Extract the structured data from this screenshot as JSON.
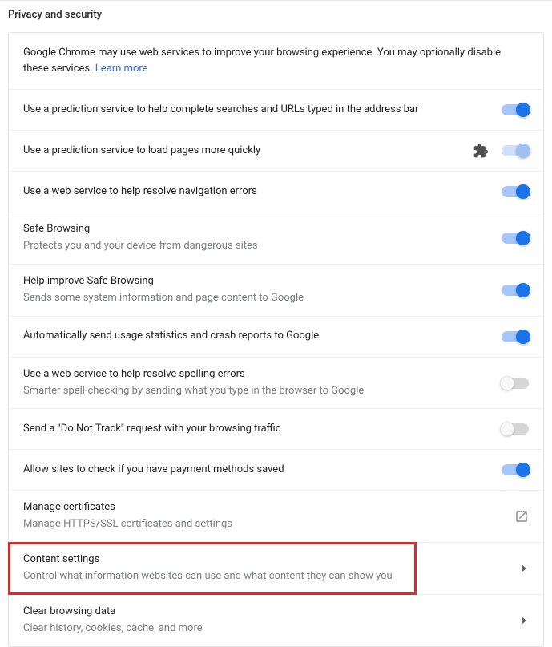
{
  "header": {
    "title": "Privacy and security"
  },
  "intro": {
    "text": "Google Chrome may use web services to improve your browsing experience. You may optionally disable these services. ",
    "link_label": "Learn more"
  },
  "rows": {
    "prediction_search": {
      "title": "Use a prediction service to help complete searches and URLs typed in the address bar"
    },
    "prediction_pages": {
      "title": "Use a prediction service to load pages more quickly"
    },
    "nav_errors": {
      "title": "Use a web service to help resolve navigation errors"
    },
    "safe_browsing": {
      "title": "Safe Browsing",
      "subtitle": "Protects you and your device from dangerous sites"
    },
    "improve_sb": {
      "title": "Help improve Safe Browsing",
      "subtitle": "Sends some system information and page content to Google"
    },
    "crash_reports": {
      "title": "Automatically send usage statistics and crash reports to Google"
    },
    "spelling": {
      "title": "Use a web service to help resolve spelling errors",
      "subtitle": "Smarter spell-checking by sending what you type in the browser to Google"
    },
    "dnt": {
      "title": "Send a \"Do Not Track\" request with your browsing traffic"
    },
    "payment": {
      "title": "Allow sites to check if you have payment methods saved"
    },
    "certs": {
      "title": "Manage certificates",
      "subtitle": "Manage HTTPS/SSL certificates and settings"
    },
    "content": {
      "title": "Content settings",
      "subtitle": "Control what information websites can use and what content they can show you"
    },
    "clear": {
      "title": "Clear browsing data",
      "subtitle": "Clear history, cookies, cache, and more"
    }
  }
}
